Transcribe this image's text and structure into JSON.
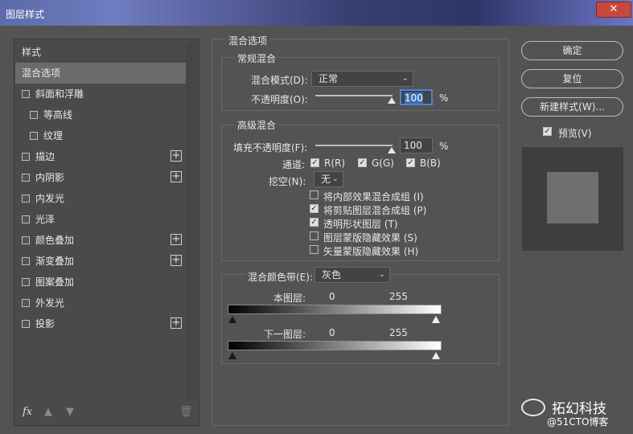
{
  "window": {
    "title": "图层样式",
    "close_icon": "close-icon"
  },
  "left": {
    "header": "样式",
    "items": [
      {
        "label": "混合选项",
        "checkbox": false,
        "selected": true,
        "plus": false
      },
      {
        "label": "斜面和浮雕",
        "checkbox": true,
        "selected": false,
        "plus": false
      },
      {
        "label": "等高线",
        "checkbox": true,
        "selected": false,
        "plus": false,
        "sub": true
      },
      {
        "label": "纹理",
        "checkbox": true,
        "selected": false,
        "plus": false,
        "sub": true
      },
      {
        "label": "描边",
        "checkbox": true,
        "selected": false,
        "plus": true
      },
      {
        "label": "内阴影",
        "checkbox": true,
        "selected": false,
        "plus": true
      },
      {
        "label": "内发光",
        "checkbox": true,
        "selected": false,
        "plus": false
      },
      {
        "label": "光泽",
        "checkbox": true,
        "selected": false,
        "plus": false
      },
      {
        "label": "颜色叠加",
        "checkbox": true,
        "selected": false,
        "plus": true
      },
      {
        "label": "渐变叠加",
        "checkbox": true,
        "selected": false,
        "plus": true
      },
      {
        "label": "图案叠加",
        "checkbox": true,
        "selected": false,
        "plus": false
      },
      {
        "label": "外发光",
        "checkbox": true,
        "selected": false,
        "plus": false
      },
      {
        "label": "投影",
        "checkbox": true,
        "selected": false,
        "plus": true
      }
    ],
    "footer": {
      "fx": "fx",
      "up_icon": "arrow-up-icon",
      "down_icon": "arrow-down-icon",
      "trash_icon": "trash-icon"
    }
  },
  "blend": {
    "section_title": "混合选项",
    "general": {
      "title": "常规混合",
      "blend_mode_label": "混合模式(D):",
      "blend_mode_value": "正常",
      "opacity_label": "不透明度(O):",
      "opacity_value": "100",
      "opacity_unit": "%"
    },
    "advanced": {
      "title": "高级混合",
      "fill_label": "填充不透明度(F):",
      "fill_value": "100",
      "fill_unit": "%",
      "channels_label": "通道:",
      "channel_r": "R(R)",
      "channel_g": "G(G)",
      "channel_b": "B(B)",
      "knockout_label": "挖空(N):",
      "knockout_value": "无",
      "options": [
        {
          "label": "将内部效果混合成组 (I)",
          "checked": false
        },
        {
          "label": "将剪贴图层混合成组 (P)",
          "checked": true
        },
        {
          "label": "透明形状图层 (T)",
          "checked": true
        },
        {
          "label": "图层蒙版隐藏效果 (S)",
          "checked": false
        },
        {
          "label": "矢量蒙版隐藏效果 (H)",
          "checked": false
        }
      ]
    },
    "blend_if": {
      "label": "混合颜色带(E):",
      "value": "灰色",
      "this_layer": "本图层:",
      "under_layer": "下一图层:",
      "this_min": "0",
      "this_max": "255",
      "under_min": "0",
      "under_max": "255"
    }
  },
  "right": {
    "ok": "确定",
    "reset": "复位",
    "new_style": "新建样式(W)...",
    "preview_label": "预览(V)",
    "preview_checked": true
  },
  "watermark": {
    "line1": "拓幻科技",
    "line2": "@51CTO博客"
  }
}
